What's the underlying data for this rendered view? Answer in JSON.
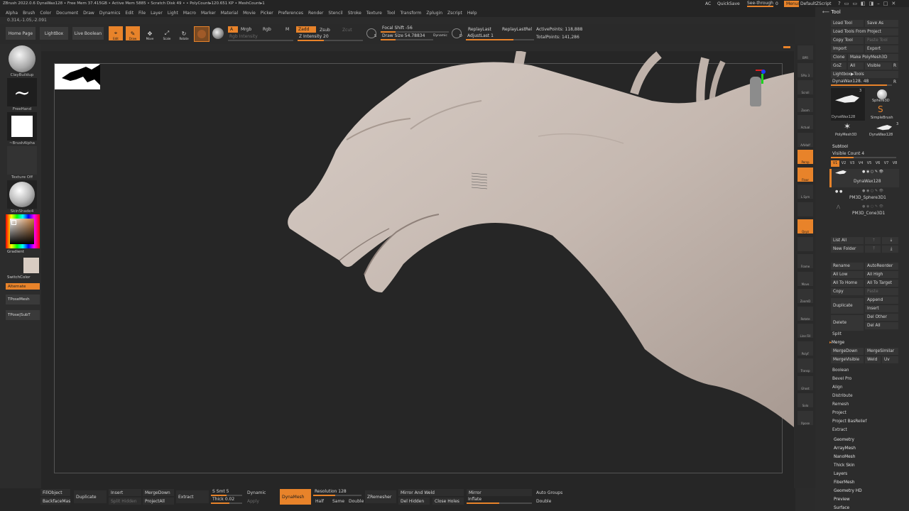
{
  "menubar": {
    "status": "ZBrush 2022.0.6   DynaWax128  • Free Mem 37.415GB • Active Mem 5885 • Scratch Disk 49 • • PolyCount▸120.651 KP • MeshCount▸1",
    "coords": "0.314,-1.05,-2.091",
    "menus": [
      "Alpha",
      "Brush",
      "Color",
      "Document",
      "Draw",
      "Dynamics",
      "Edit",
      "File",
      "Layer",
      "Light",
      "Macro",
      "Marker",
      "Material",
      "Movie",
      "Picker",
      "Preferences",
      "Render",
      "Stencil",
      "Stroke",
      "Texture",
      "Tool",
      "Transform",
      "Zplugin",
      "Zscript",
      "Help"
    ],
    "right": {
      "ac": "AC",
      "quicksave": "QuickSave",
      "seethrough": "See-through",
      "seethrough_value": "0",
      "menus": "Menus",
      "script": "DefaultZScript"
    }
  },
  "toolbar": {
    "home": "Home Page",
    "lightbox": "LightBox",
    "liveboolean": "Live Boolean",
    "edit": "Edit",
    "draw": "Draw",
    "move": "Move",
    "scale": "Scale",
    "rotate": "Rotate",
    "a": "A",
    "mrgb": "Mrgb",
    "rgb": "Rgb",
    "m": "M",
    "rgb_intensity": "Rgb Intensity",
    "zadd": "Zadd",
    "zsub": "Zsub",
    "zcut": "Zcut",
    "z_intensity": "Z Intensity 20",
    "focal_shift": "Focal Shift -56",
    "draw_size": "Draw Size 54.78834",
    "dynamic": "Dynamic",
    "replaylast": "ReplayLast",
    "replaylastrel": "ReplayLastRel",
    "adjustlast": "AdjustLast 1",
    "activepoints": "ActivePoints: 118,888",
    "totalpoints": "TotalPoints: 141,286",
    "s_key": "S",
    "d_key": "D"
  },
  "leftshelf": {
    "brush": "ClayBuildup",
    "stroke": "FreeHand",
    "alpha": "~BrushAlpha",
    "texture": "Texture Off",
    "material": "SkinShade4",
    "gradient": "Gradient",
    "switchcolor": "SwitchColor",
    "alternate": "Alternate",
    "tposemesh": "TPoseMesh",
    "tposesubt": "TPose|SubT"
  },
  "rightshelf": {
    "items": [
      "BPR",
      "SPix 3",
      "Scroll",
      "Zoom",
      "Actual",
      "AAHalf",
      "Persp",
      "Floor",
      "L.Sym",
      "",
      "Qxyz",
      "",
      "Frame",
      "Move",
      "ZoomD",
      "Rotate",
      "Line Fill",
      "PolyF",
      "Transp",
      "Ghost",
      "Solo",
      "Xpose"
    ]
  },
  "toolpanel": {
    "title": "Tool",
    "load_tool": "Load Tool",
    "save_as": "Save As",
    "load_project": "Load Tools From Project",
    "copy_tool": "Copy Tool",
    "paste_tool": "Paste Tool",
    "import": "Import",
    "export": "Export",
    "clone": "Clone",
    "make_polymesh": "Make PolyMesh3D",
    "goz": "GoZ",
    "all": "All",
    "visible": "Visible",
    "r": "R",
    "lightbox_tools": "Lightbox▶Tools",
    "current_tool": "DynaWax128. 48",
    "r2": "R",
    "thumbs": [
      "DynaWax128",
      "Sphere3D",
      "SimpleBrush",
      "PolyMesh3D",
      "DynaWax128"
    ],
    "thumb_counts": [
      "3",
      "3"
    ],
    "subtool": "Subtool",
    "visible_count": "Visible Count 4",
    "vtabs": [
      "V1",
      "V2",
      "V3",
      "V4",
      "V5",
      "V6",
      "V7",
      "V8"
    ],
    "subtools": [
      "DynaWax128",
      "PM3D_Sphere3D1",
      "PM3D_Cone3D1"
    ],
    "list_all": "List All",
    "new_folder": "New Folder",
    "rename": "Rename",
    "autoreorder": "AutoReorder",
    "all_low": "All Low",
    "all_high": "All High",
    "all_to_home": "All To Home",
    "all_to_target": "All To Target",
    "copy": "Copy",
    "paste": "Paste",
    "duplicate": "Duplicate",
    "append": "Append",
    "insert": "Insert",
    "delete": "Delete",
    "del_other": "Del Other",
    "del_all": "Del All",
    "split": "Split",
    "merge": "Merge",
    "mergedown": "MergeDown",
    "mergesimilar": "MergeSimilar",
    "mergevisible": "MergeVisible",
    "weld": "Weld",
    "uv": "Uv",
    "sections": [
      "Boolean",
      "Bevel Pro",
      "Align",
      "Distribute",
      "Remesh",
      "Project",
      "Project BasRelief",
      "Extract"
    ],
    "categories": [
      "Geometry",
      "ArrayMesh",
      "NanoMesh",
      "Thick Skin",
      "Layers",
      "FiberMesh",
      "Geometry HD",
      "Preview",
      "Surface"
    ]
  },
  "bottombar": {
    "fillobject": "FillObject",
    "backfacemask": "BackfaceMask",
    "duplicate": "Duplicate",
    "insert": "Insert",
    "split_hidden": "Split Hidden",
    "mergedown": "MergeDown",
    "projectall": "ProjectAll",
    "extract": "Extract",
    "s_smt": "S Smt 5",
    "thick": "Thick 0.02",
    "dynamic": "Dynamic",
    "apply": "Apply",
    "dynamesh": "DynaMesh",
    "resolution": "Resolution 128",
    "half": "Half",
    "same": "Same",
    "double": "Double",
    "zremesher": "ZRemesher",
    "mirror_weld": "Mirror And Weld",
    "del_hidden": "Del Hidden",
    "close_holes": "Close Holes",
    "mirror": "Mirror",
    "inflate": "Inflate",
    "auto_groups": "Auto Groups",
    "double2": "Double"
  },
  "colors": {
    "accent": "#e8832a",
    "panel": "#2c2c2c",
    "viewport": "#262626",
    "model": "#c9bdb6"
  }
}
